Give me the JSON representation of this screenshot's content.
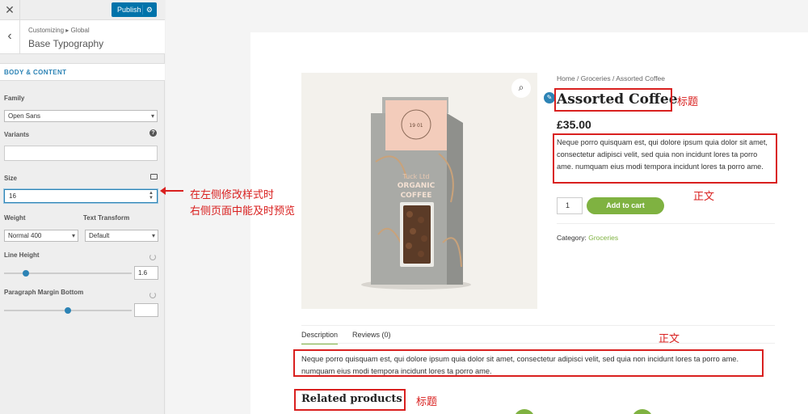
{
  "sidebar": {
    "close_icon": "close-icon",
    "publish_label": "Publish",
    "breadcrumb": "Customizing ▸ Global",
    "panel_title": "Base Typography",
    "section_title": "BODY & CONTENT",
    "family_label": "Family",
    "family_value": "Open Sans",
    "variants_label": "Variants",
    "variants_value": "",
    "size_label": "Size",
    "size_value": "16",
    "weight_label": "Weight",
    "weight_value": "Normal 400",
    "transform_label": "Text Transform",
    "transform_value": "Default",
    "line_height_label": "Line Height",
    "line_height_value": "1.6",
    "para_margin_label": "Paragraph Margin Bottom",
    "para_margin_value": ""
  },
  "annotations": {
    "arrow_note_line1": "在左侧修改样式时",
    "arrow_note_line2": "右侧页面中能及时预览",
    "title_tag": "标题",
    "body_tag": "正文",
    "body_tag_2": "正文",
    "related_tag": "标题",
    "color": "#d9201f"
  },
  "product": {
    "breadcrumb": "Home / Groceries / Assorted Coffee",
    "title": "Assorted Coffee",
    "price": "£35.00",
    "short_description": "Neque porro quisquam est, qui dolore ipsum quia dolor sit amet, consectetur adipisci velit, sed quia non incidunt lores ta porro ame. numquam eius modi tempora incidunt lores ta porro ame.",
    "quantity": "1",
    "add_to_cart": "Add to cart",
    "category_label": "Category:",
    "category_value": "Groceries",
    "package_text_top": "Tuck Ltd",
    "package_text_mid": "ORGANIC",
    "package_text_bot": "COFFEE",
    "package_badge": "19 01",
    "accent_color": "#7fb241"
  },
  "tabs": {
    "description": "Description",
    "reviews": "Reviews (0)"
  },
  "long_description": "Neque porro quisquam est, qui dolore ipsum quia dolor sit amet, consectetur adipisci velit, sed quia non incidunt lores ta porro ame. numquam eius modi tempora incidunt lores ta porro ame.",
  "related_title": "Related products"
}
